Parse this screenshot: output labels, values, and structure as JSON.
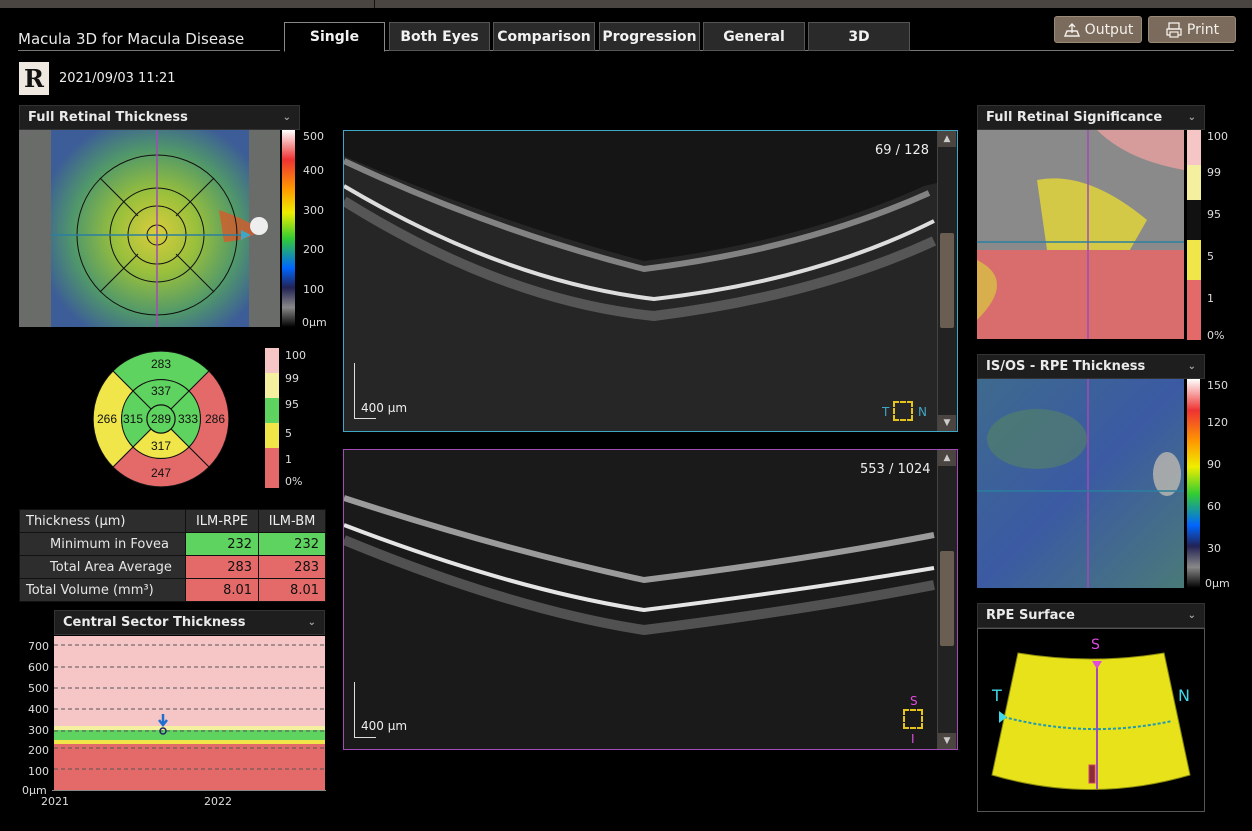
{
  "app": {
    "title": "Macula 3D for Macula Disease"
  },
  "tabs": [
    "Single",
    "Both Eyes",
    "Comparison",
    "Progression",
    "General",
    "3D"
  ],
  "buttons": {
    "output": "Output",
    "print": "Print"
  },
  "eye": "R",
  "datetime": "2021/09/03  11:21",
  "panels": {
    "frt": "Full Retinal Thickness",
    "frs": "Full Retinal Significance",
    "isos": "IS/OS - RPE Thickness",
    "rpe": "RPE Surface",
    "cst": "Central Sector Thickness"
  },
  "frt_scale": [
    "500",
    "400",
    "300",
    "200",
    "100",
    "0µm"
  ],
  "frs_scale": [
    "100",
    "99",
    "95",
    "5",
    "1",
    "0%"
  ],
  "isos_scale": [
    "150",
    "120",
    "90",
    "60",
    "30",
    "0µm"
  ],
  "etdrs": {
    "sup_outer": "283",
    "sup_inner": "337",
    "temp_outer": "266",
    "temp_inner": "315",
    "center": "289",
    "nas_inner": "333",
    "nas_outer": "286",
    "inf_inner": "317",
    "inf_outer": "247"
  },
  "etdrs_legend": [
    "100",
    "99",
    "95",
    "5",
    "1",
    "0%"
  ],
  "table": {
    "headers": [
      "Thickness (µm)",
      "ILM-RPE",
      "ILM-BM"
    ],
    "rows": [
      {
        "label": "Minimum in Fovea",
        "a": "232",
        "b": "232"
      },
      {
        "label": "Total Area Average",
        "a": "283",
        "b": "283"
      },
      {
        "label": "Total Volume (mm³)",
        "a": "8.01",
        "b": "8.01"
      }
    ]
  },
  "cst_chart": {
    "yticks": [
      "700",
      "600",
      "500",
      "400",
      "300",
      "200",
      "100",
      "0µm"
    ],
    "xticks": [
      "2021",
      "2022"
    ]
  },
  "scan1": {
    "counter": "69 / 128",
    "scale": "400 µm",
    "dir_t": "T",
    "dir_n": "N"
  },
  "scan2": {
    "counter": "553 / 1024",
    "scale": "400 µm",
    "dir_s": "S",
    "dir_i": "I"
  },
  "rpe_surface": {
    "s": "S",
    "t": "T",
    "n": "N"
  },
  "colors": {
    "green": "#5fd35f",
    "yellow": "#f0e64a",
    "red": "#e46a6a",
    "pink": "#f6c6c6",
    "tabbar": "#2a2a2a",
    "accent_brown": "#7a6b5c",
    "scan1_border": "#3fa7c4",
    "scan2_border": "#a24ab6"
  }
}
